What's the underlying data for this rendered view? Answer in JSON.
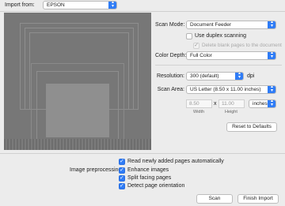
{
  "header": {
    "import_from_label": "Import from:",
    "device": "EPSON"
  },
  "settings": {
    "scan_mode_label": "Scan Mode:",
    "scan_mode_value": "Document Feeder",
    "duplex_label": "Use duplex scanning",
    "duplex_checked": false,
    "delete_blank_label": "Delete blank pages to the document",
    "delete_blank_checked": true,
    "color_depth_label": "Color Depth:",
    "color_depth_value": "Full Color",
    "resolution_label": "Resolution:",
    "resolution_value": "300 (default)",
    "resolution_unit": "dpi",
    "scan_area_label": "Scan Area:",
    "scan_area_value": "US Letter (8.50 x 11.00 inches)",
    "width_value": "8.50",
    "times_sign": "x",
    "height_value": "11.00",
    "units_value": "inches",
    "width_caption": "Width",
    "height_caption": "Height",
    "reset_button": "Reset to Defaults"
  },
  "options": {
    "read_new_label": "Read newly added pages automatically",
    "image_preprocessing_label": "Image preprocessing:",
    "enhance_label": "Enhance images",
    "split_label": "Split facing pages",
    "detect_label": "Detect page orientation",
    "checkmark": "✓"
  },
  "footer": {
    "scan_button": "Scan",
    "finish_button": "Finish Import"
  },
  "colors": {
    "accent": "#2f7cf6",
    "preview_bg": "#777777",
    "window_bg": "#ececec"
  }
}
